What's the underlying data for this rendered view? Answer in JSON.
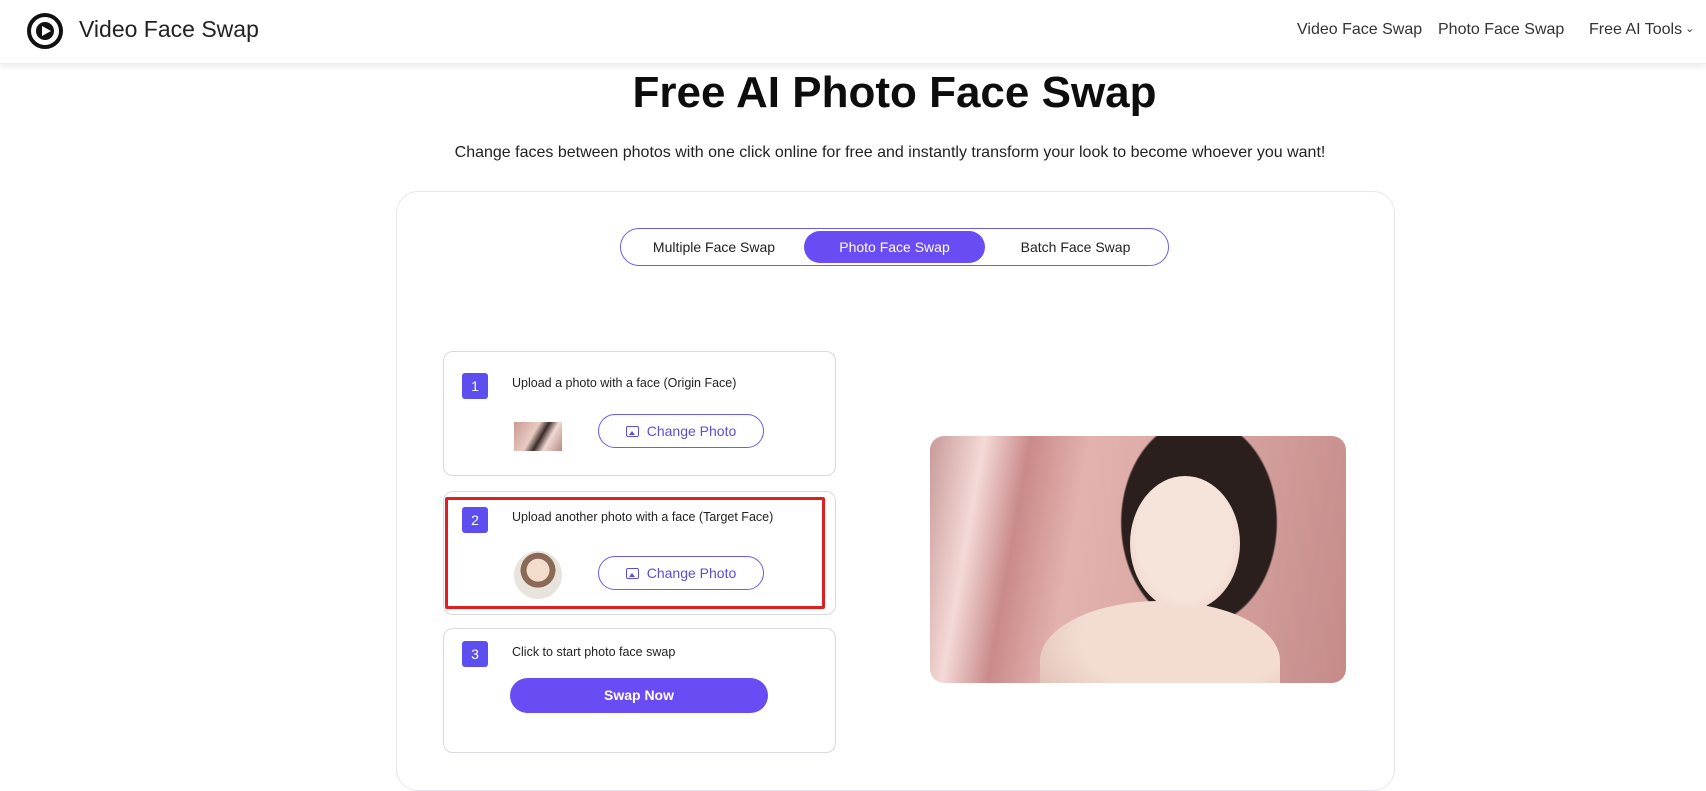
{
  "header": {
    "brand": "Video Face Swap",
    "nav": [
      "Video Face Swap",
      "Photo Face Swap",
      "Free AI Tools"
    ]
  },
  "hero": {
    "title": "Free AI Photo Face Swap",
    "subtitle": "Change faces between photos with one click online for free and instantly transform your look to become whoever you want!"
  },
  "tabs": [
    "Multiple Face Swap",
    "Photo Face Swap",
    "Batch Face Swap"
  ],
  "active_tab": "Photo Face Swap",
  "steps": [
    {
      "number": "1",
      "text": "Upload a photo with a face  (Origin Face)",
      "button": "Change Photo"
    },
    {
      "number": "2",
      "text": "Upload another photo with a face  (Target Face)",
      "button": "Change Photo"
    },
    {
      "number": "3",
      "text": "Click to start photo face swap",
      "button": "Swap Now"
    }
  ],
  "colors": {
    "accent": "#6a4cf5",
    "highlight": "#e02020"
  },
  "icons": [
    "logo-icon",
    "chevron-down-icon",
    "image-icon"
  ]
}
